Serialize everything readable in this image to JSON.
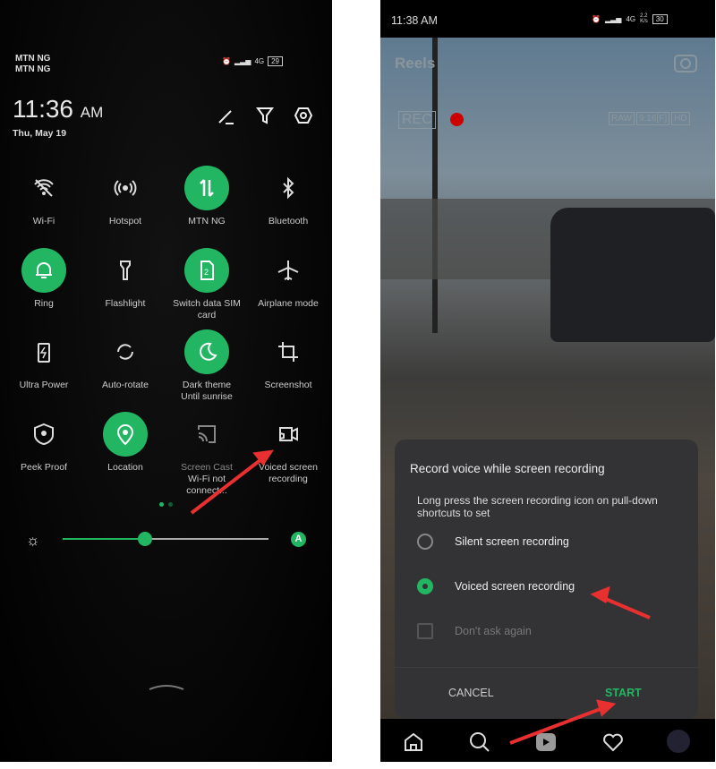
{
  "left": {
    "carriers": [
      "MTN NG",
      "MTN NG"
    ],
    "battery": "29",
    "signal": "4G",
    "time": "11:36",
    "ampm": "AM",
    "date": "Thu, May 19",
    "header_icons": [
      "edit-icon",
      "filter-icon",
      "settings-icon"
    ],
    "tiles": [
      {
        "label": "Wi-Fi",
        "icon": "wifi-icon",
        "on": false
      },
      {
        "label": "Hotspot",
        "icon": "hotspot-icon",
        "on": false
      },
      {
        "label": "MTN NG",
        "icon": "mobile-data-icon",
        "on": true
      },
      {
        "label": "Bluetooth",
        "icon": "bluetooth-icon",
        "on": false
      },
      {
        "label": "Ring",
        "icon": "bell-icon",
        "on": true
      },
      {
        "label": "Flashlight",
        "icon": "flashlight-icon",
        "on": false
      },
      {
        "label": "Switch data SIM card",
        "icon": "sim-icon",
        "on": true
      },
      {
        "label": "Airplane mode",
        "icon": "airplane-icon",
        "on": false
      },
      {
        "label": "Ultra Power",
        "icon": "battery-icon",
        "on": false
      },
      {
        "label": "Auto-rotate",
        "icon": "rotate-icon",
        "on": false
      },
      {
        "label": "Dark theme",
        "sub": "Until sunrise",
        "icon": "moon-icon",
        "on": true
      },
      {
        "label": "Screenshot",
        "icon": "crop-icon",
        "on": false
      },
      {
        "label": "Peek Proof",
        "icon": "eye-shield-icon",
        "on": false
      },
      {
        "label": "Location",
        "icon": "location-icon",
        "on": true
      },
      {
        "label": "Screen Cast",
        "sub": "Wi-Fi not connect...",
        "icon": "cast-icon",
        "on": false
      },
      {
        "label": "Voiced screen recording",
        "icon": "screen-record-icon",
        "on": false
      }
    ],
    "brightness_percent": 40,
    "auto_brightness": "A",
    "accent": "#22b663"
  },
  "right": {
    "time": "11:38 AM",
    "speed": "2.2",
    "speed_unit": "K/s",
    "battery": "30",
    "signal": "4G",
    "title": "Reels",
    "rec": "REC",
    "overlay_tags": [
      "RAW",
      "9:16[F]",
      "HD"
    ],
    "dialog": {
      "title": "Record voice while screen recording",
      "desc": "Long press the screen recording icon on pull-down shortcuts to set",
      "options": [
        {
          "label": "Silent screen recording",
          "selected": false
        },
        {
          "label": "Voiced screen recording",
          "selected": true
        }
      ],
      "checkbox": "Don't ask again",
      "cancel": "CANCEL",
      "start": "START"
    },
    "nav": [
      "home-icon",
      "search-icon",
      "reels-icon",
      "heart-icon",
      "profile-avatar"
    ]
  }
}
